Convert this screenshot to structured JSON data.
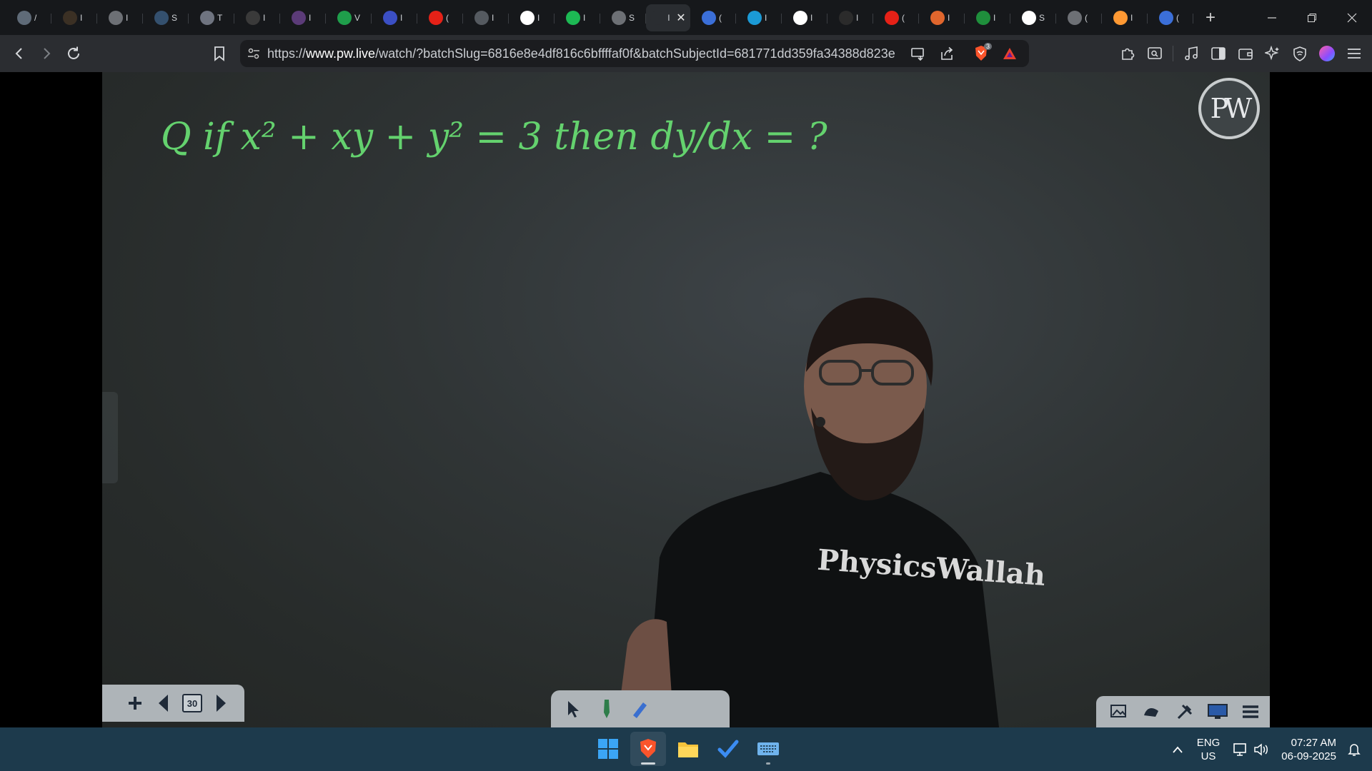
{
  "browser": {
    "tabs": [
      {
        "icon": "chat-bubble-icon",
        "title": "/",
        "color": "#5f6b78"
      },
      {
        "icon": "spiral-logo-icon",
        "title": "I",
        "color": "#3b3024"
      },
      {
        "icon": "globe-icon",
        "title": "I",
        "color": "#6d7075"
      },
      {
        "icon": "xml-logo-icon",
        "title": "S",
        "color": "#34506e"
      },
      {
        "icon": "w3schools-icon",
        "title": "T",
        "color": "#6f7480"
      },
      {
        "icon": "ml-logo-icon",
        "title": "I",
        "color": "#3a3a3a"
      },
      {
        "icon": "purple-avatar-icon",
        "title": "I",
        "color": "#5b3b78"
      },
      {
        "icon": "whatsapp-icon",
        "title": "V",
        "color": "#1f9e4b"
      },
      {
        "icon": "bookmark-flag-icon",
        "title": "I",
        "color": "#3b4fc4"
      },
      {
        "icon": "youtube-icon",
        "title": "(",
        "color": "#e62117"
      },
      {
        "icon": "orkut-logo-icon",
        "title": "I",
        "color": "#555a60"
      },
      {
        "icon": "google-icon",
        "title": "I",
        "color": "#ffffff"
      },
      {
        "icon": "spotify-icon",
        "title": "I",
        "color": "#1db954"
      },
      {
        "icon": "globe-icon",
        "title": "S",
        "color": "#6d7075"
      },
      {
        "icon": "pw-favicon",
        "title": "I",
        "color": "#2a2d31",
        "active": true
      },
      {
        "icon": "gemini-icon",
        "title": "(",
        "color": "#3b6fd8"
      },
      {
        "icon": "pw-square-icon",
        "title": "I",
        "color": "#1b9ad6"
      },
      {
        "icon": "google-icon",
        "title": "I",
        "color": "#ffffff"
      },
      {
        "icon": "monitor-icon",
        "title": "I",
        "color": "#2b2b2b"
      },
      {
        "icon": "youtube-icon",
        "title": "(",
        "color": "#e62117"
      },
      {
        "icon": "orange-logo-icon",
        "title": "I",
        "color": "#e0662d"
      },
      {
        "icon": "chart-logo-icon",
        "title": "I",
        "color": "#1f8f3c"
      },
      {
        "icon": "wikipedia-icon",
        "title": "S",
        "color": "#ffffff"
      },
      {
        "icon": "globe-icon",
        "title": "(",
        "color": "#6d7075"
      },
      {
        "icon": "india-flag-icon",
        "title": "I",
        "color": "#ff9933"
      },
      {
        "icon": "gemini-icon",
        "title": "(",
        "color": "#3b6fd8"
      }
    ],
    "url": {
      "scheme": "https://",
      "host": "www.pw.live",
      "path": "/watch/?batchSlug=6816e8e4df816c6bffffaf0f&batchSubjectId=681771dd359fa34388d823e..."
    },
    "shields_count": "3"
  },
  "video": {
    "whiteboard_text": "Q  if x² + xy + y² = 3  then dy/dx = ?",
    "logo_text": "PW",
    "shirt_text": "PhysicsWallah",
    "page_counter": "30"
  },
  "taskbar": {
    "language_top": "ENG",
    "language_bottom": "US",
    "time": "07:27 AM",
    "date": "06-09-2025"
  }
}
